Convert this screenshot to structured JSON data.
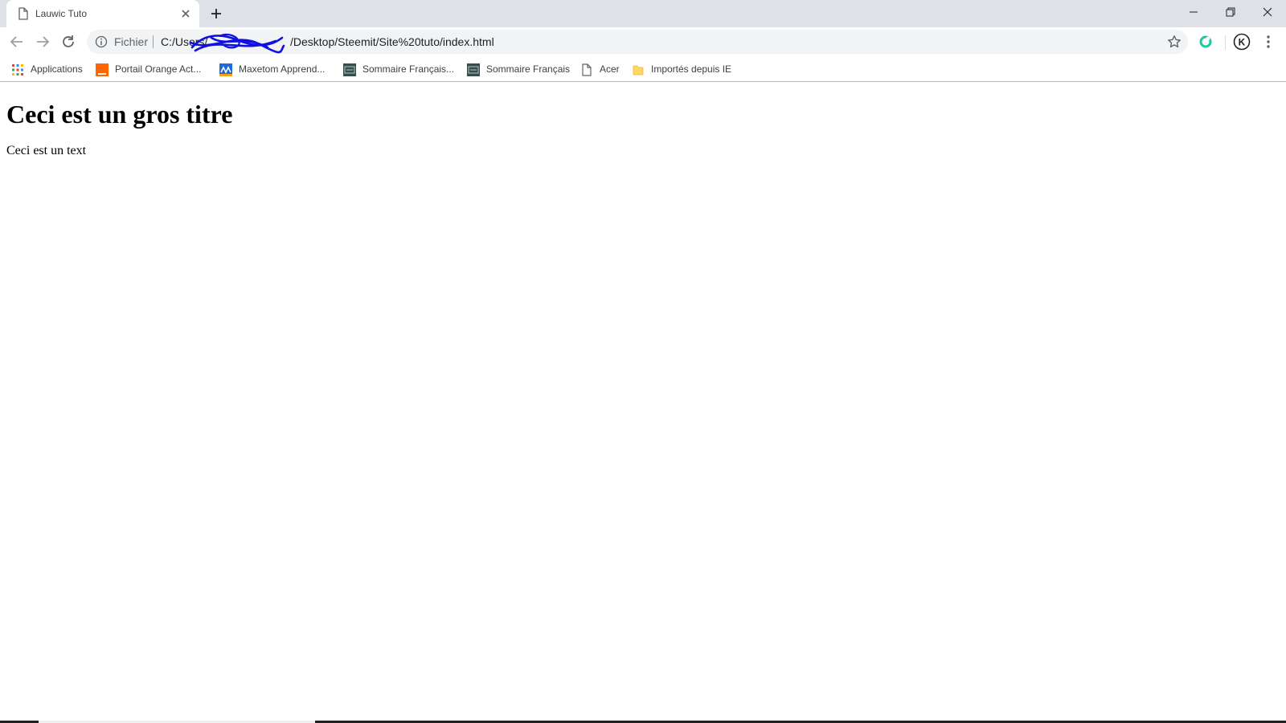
{
  "tab": {
    "title": "Lauwic Tuto"
  },
  "omnibox": {
    "scheme": "Fichier",
    "url_start": "C:/Users/",
    "url_end": "/Desktop/Steemit/Site%20tuto/index.html"
  },
  "avatar": {
    "initial": "K"
  },
  "bookmarks": [
    {
      "label": "Applications",
      "icon": "apps-grid-icon"
    },
    {
      "label": "Portail Orange  Act...",
      "icon": "orange-favicon"
    },
    {
      "label": "Maxetom  Apprend...",
      "icon": "maxetom-favicon"
    },
    {
      "label": "Sommaire Français...",
      "icon": "sommaire-favicon"
    },
    {
      "label": "Sommaire Français",
      "icon": "sommaire-favicon"
    },
    {
      "label": "Acer",
      "icon": "page-icon"
    },
    {
      "label": "Importés depuis IE",
      "icon": "folder-icon"
    }
  ],
  "page": {
    "heading": "Ceci est un gros titre",
    "paragraph": "Ceci est un text"
  },
  "colors": {
    "tabbar": "#dee1e6",
    "omnibox": "#f1f3f4",
    "scribble": "#1010e0",
    "extension": "#1ec9a0",
    "orange": "#ff6600"
  }
}
